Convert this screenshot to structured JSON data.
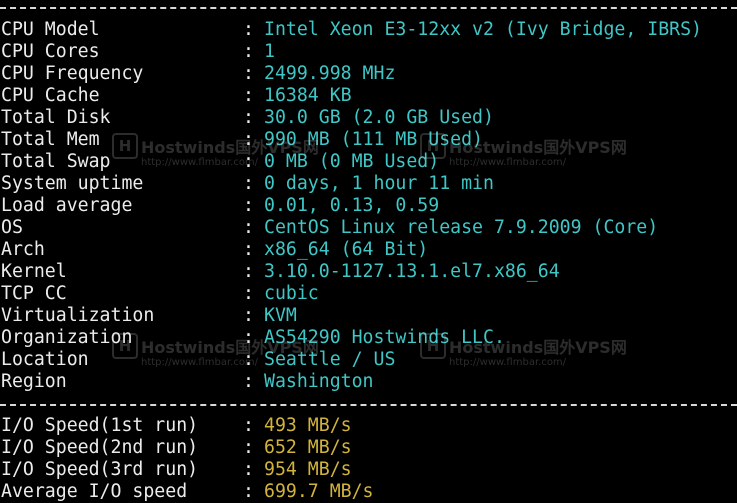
{
  "system_info": [
    {
      "label": "CPU Model",
      "value": "Intel Xeon E3-12xx v2 (Ivy Bridge, IBRS)"
    },
    {
      "label": "CPU Cores",
      "value": "1"
    },
    {
      "label": "CPU Frequency",
      "value": "2499.998 MHz"
    },
    {
      "label": "CPU Cache",
      "value": "16384 KB"
    },
    {
      "label": "Total Disk",
      "value": "30.0 GB (2.0 GB Used)"
    },
    {
      "label": "Total Mem",
      "value": "990 MB (111 MB Used)"
    },
    {
      "label": "Total Swap",
      "value": "0 MB (0 MB Used)"
    },
    {
      "label": "System uptime",
      "value": "0 days, 1 hour 11 min"
    },
    {
      "label": "Load average",
      "value": "0.01, 0.13, 0.59"
    },
    {
      "label": "OS",
      "value": "CentOS Linux release 7.9.2009 (Core)"
    },
    {
      "label": "Arch",
      "value": "x86_64 (64 Bit)"
    },
    {
      "label": "Kernel",
      "value": "3.10.0-1127.13.1.el7.x86_64"
    },
    {
      "label": "TCP CC",
      "value": "cubic"
    },
    {
      "label": "Virtualization",
      "value": "KVM"
    },
    {
      "label": "Organization",
      "value": "AS54290 Hostwinds LLC."
    },
    {
      "label": "Location",
      "value": "Seattle / US"
    },
    {
      "label": "Region",
      "value": "Washington"
    }
  ],
  "io_speed": [
    {
      "label": "I/O Speed(1st run)",
      "value": "493 MB/s"
    },
    {
      "label": "I/O Speed(2nd run)",
      "value": "652 MB/s"
    },
    {
      "label": "I/O Speed(3rd run)",
      "value": "954 MB/s"
    },
    {
      "label": "Average I/O speed",
      "value": "699.7 MB/s"
    }
  ],
  "separator_colon": ":",
  "watermark": {
    "icon_letter": "H",
    "title": "Hostwinds国外VPS网",
    "url": "http://www.flmbar.com/"
  },
  "colors": {
    "background": "#000000",
    "label": "#ececec",
    "value": "#3fc6c6",
    "io_value": "#d2b33c"
  }
}
